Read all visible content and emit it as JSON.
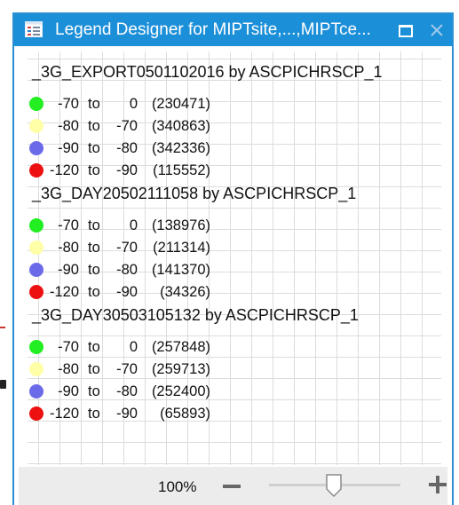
{
  "window": {
    "title": "Legend Designer for MIPTsite,...,MIPTce...",
    "accent_color": "#1c8fd9",
    "icons": {
      "app": "legend-app-icon",
      "maximize": "maximize-icon",
      "close": "close-icon"
    }
  },
  "legend": {
    "sections": [
      {
        "title": "_3G_EXPORT0501102016 by ASCPICHRSCP_1",
        "rows": [
          {
            "color": "#22ee22",
            "from": "-70",
            "to_word": "to",
            "to": "0",
            "count": "(230471)"
          },
          {
            "color": "#ffffa8",
            "from": "-80",
            "to_word": "to",
            "to": "-70",
            "count": "(340863)"
          },
          {
            "color": "#6b6bea",
            "from": "-90",
            "to_word": "to",
            "to": "-80",
            "count": "(342336)"
          },
          {
            "color": "#ee1111",
            "from": "-120",
            "to_word": "to",
            "to": "-90",
            "count": "(115552)"
          }
        ]
      },
      {
        "title": "_3G_DAY20502111058 by ASCPICHRSCP_1",
        "rows": [
          {
            "color": "#22ee22",
            "from": "-70",
            "to_word": "to",
            "to": "0",
            "count": "(138976)"
          },
          {
            "color": "#ffffa8",
            "from": "-80",
            "to_word": "to",
            "to": "-70",
            "count": "(211314)"
          },
          {
            "color": "#6b6bea",
            "from": "-90",
            "to_word": "to",
            "to": "-80",
            "count": "(141370)"
          },
          {
            "color": "#ee1111",
            "from": "-120",
            "to_word": "to",
            "to": "-90",
            "count": "(34326)"
          }
        ]
      },
      {
        "title": "_3G_DAY30503105132 by ASCPICHRSCP_1",
        "rows": [
          {
            "color": "#22ee22",
            "from": "-70",
            "to_word": "to",
            "to": "0",
            "count": "(257848)"
          },
          {
            "color": "#ffffa8",
            "from": "-80",
            "to_word": "to",
            "to": "-70",
            "count": "(259713)"
          },
          {
            "color": "#6b6bea",
            "from": "-90",
            "to_word": "to",
            "to": "-80",
            "count": "(252400)"
          },
          {
            "color": "#ee1111",
            "from": "-120",
            "to_word": "to",
            "to": "-90",
            "count": "(65893)"
          }
        ]
      }
    ]
  },
  "statusbar": {
    "zoom_level": "100%",
    "zoom_slider_value": 0.5,
    "icons": {
      "zoom_out": "minus-icon",
      "zoom_in": "plus-icon"
    }
  }
}
